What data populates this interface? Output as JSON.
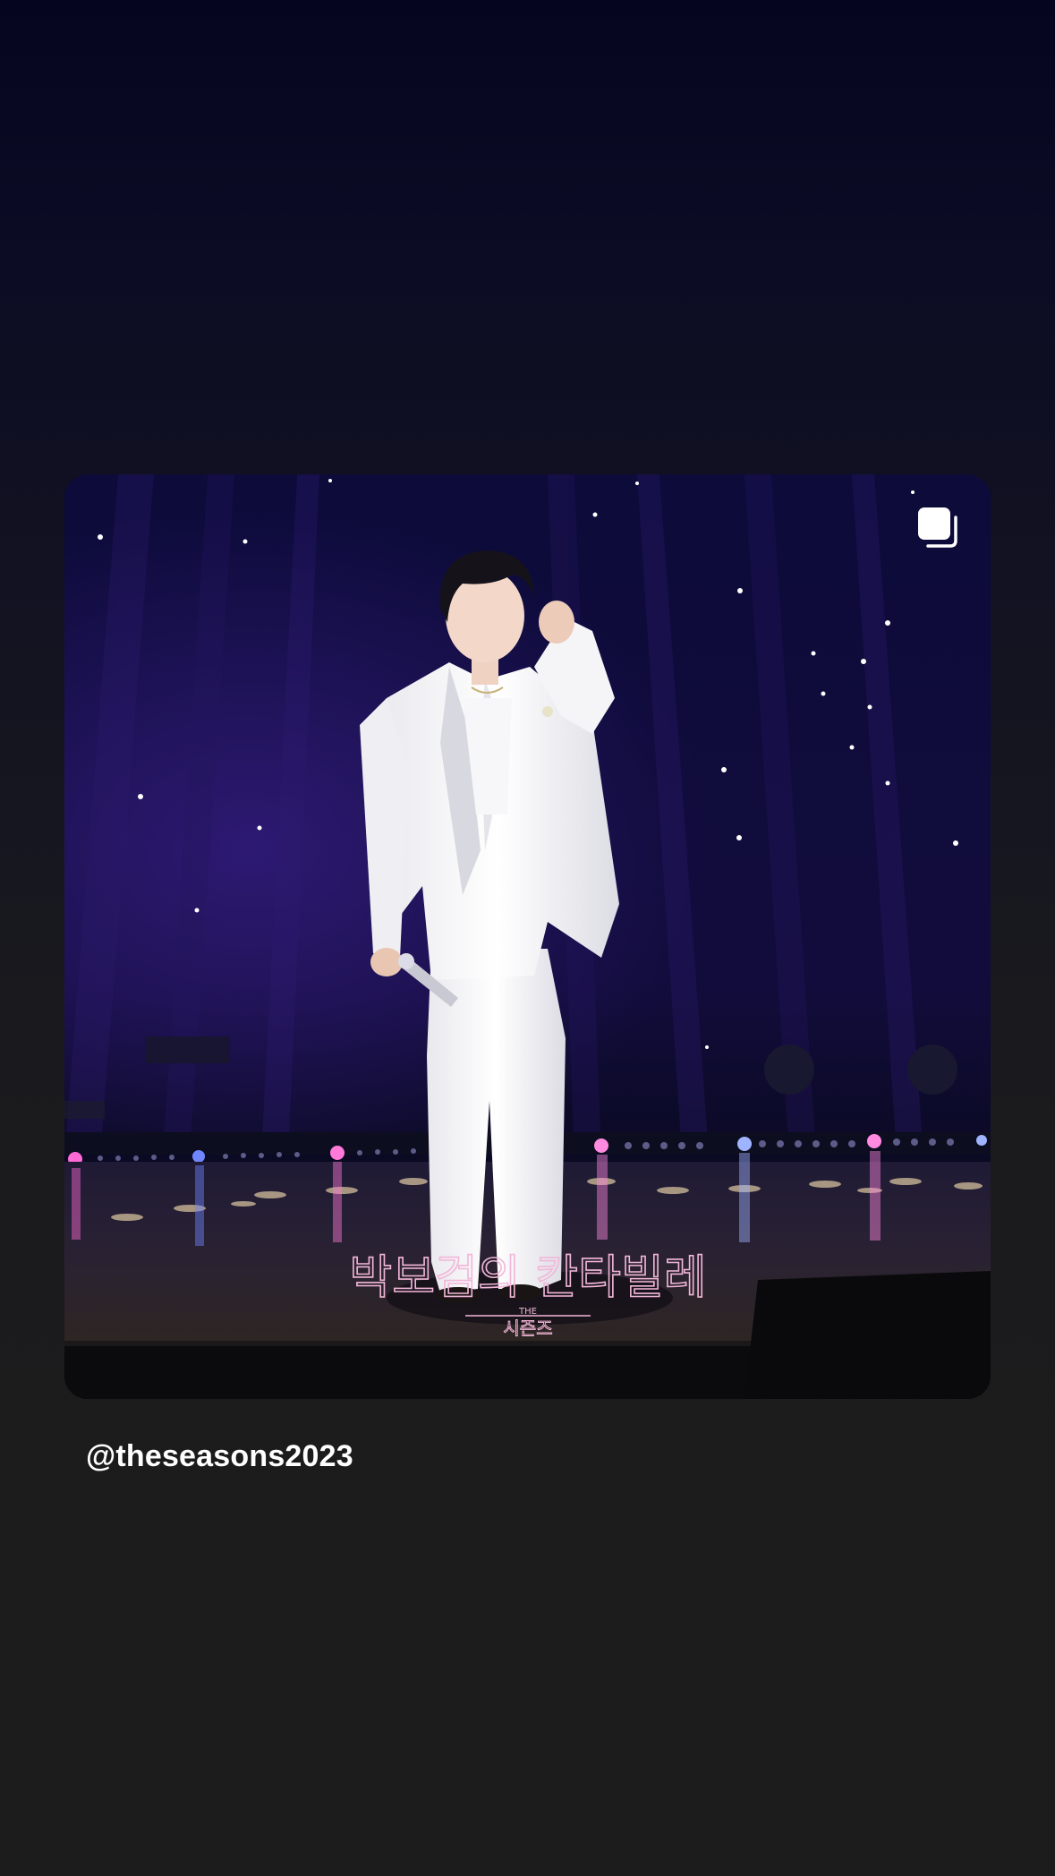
{
  "story": {
    "background": "#1c1c1c",
    "post": {
      "multi_image_icon": "carousel-stack-icon",
      "overlay_title": "박보검의 칸타빌레",
      "overlay_subtitle_the": "THE",
      "overlay_subtitle": "시즌즈",
      "overlay_color": "#f2b6d8"
    },
    "mention": "@theseasons2023"
  }
}
